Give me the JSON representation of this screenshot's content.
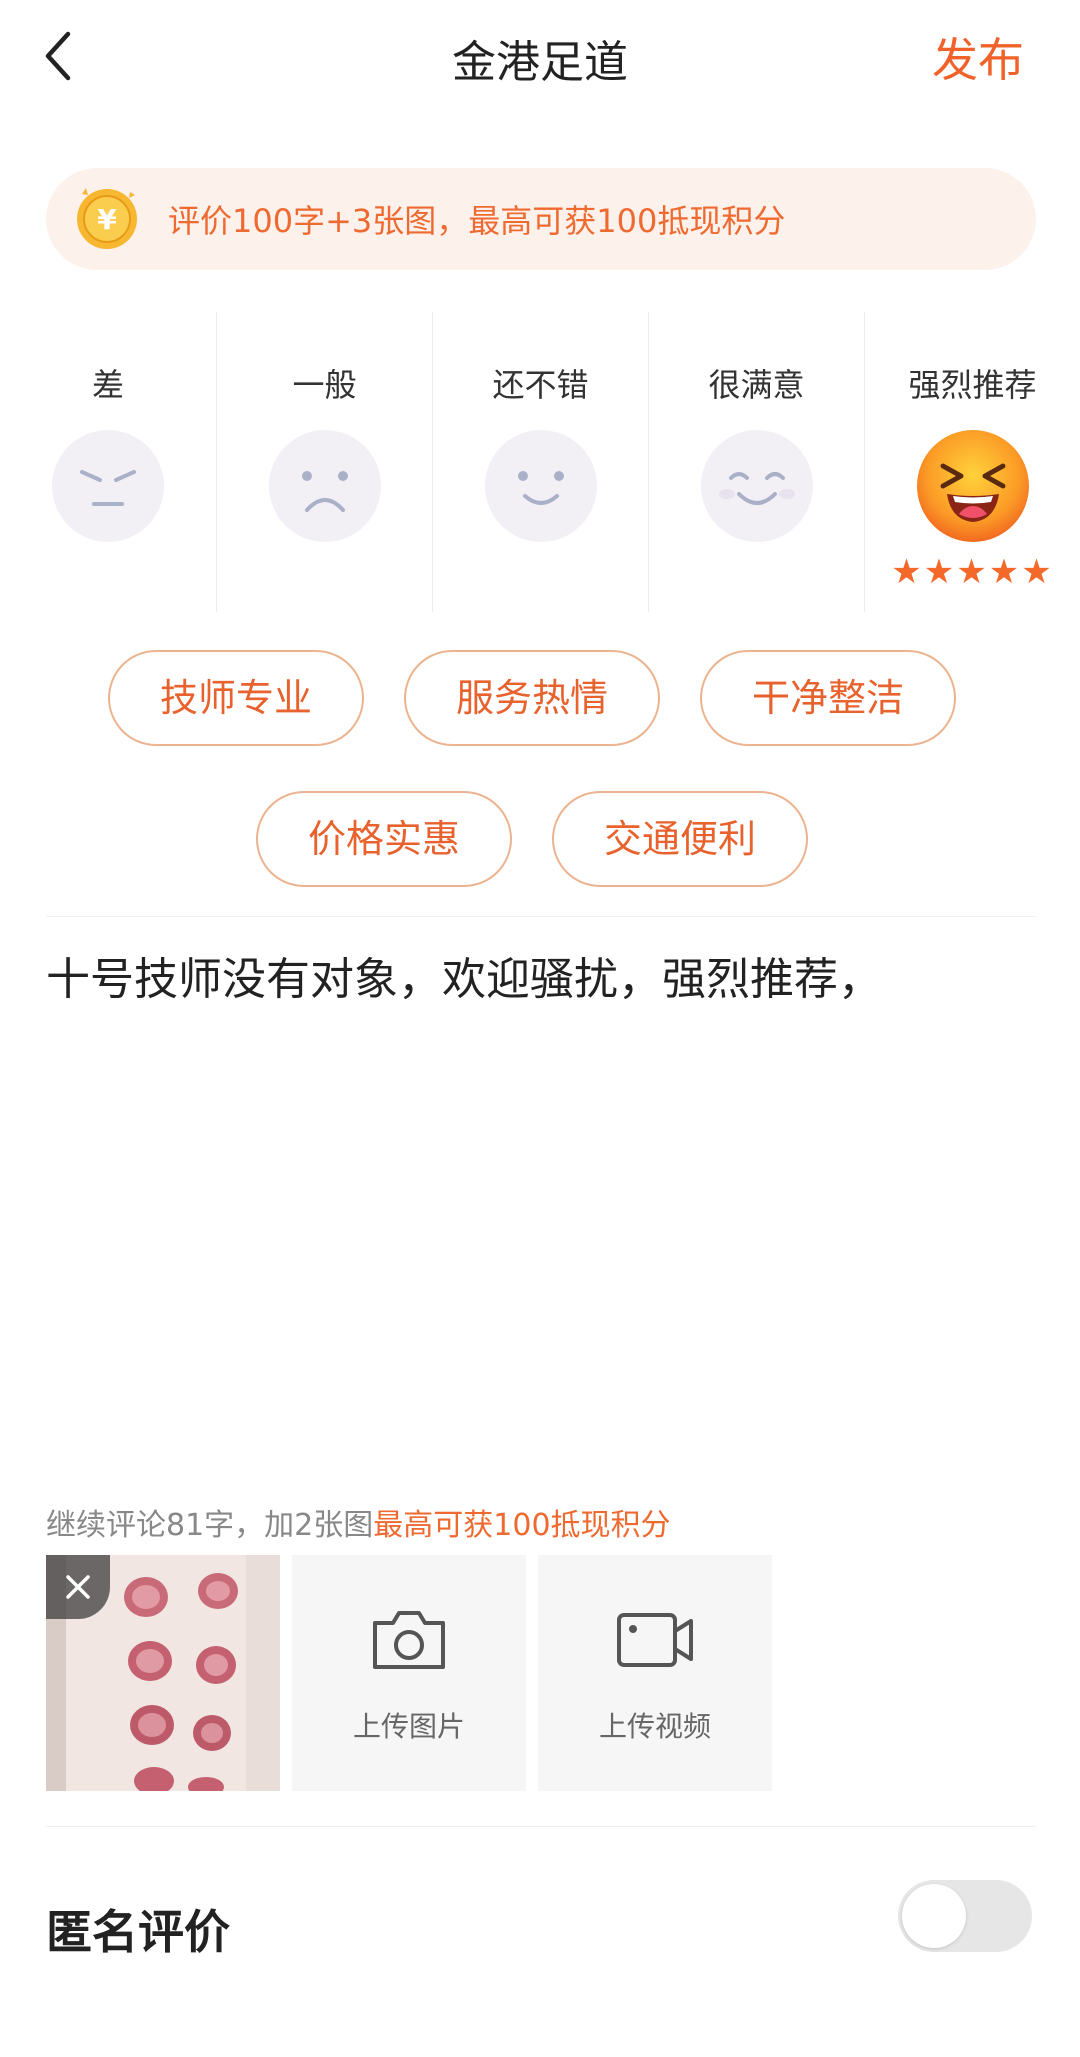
{
  "header": {
    "title": "金港足道",
    "publish_label": "发布"
  },
  "banner": {
    "text": "评价100字+3张图，最高可获100抵现积分"
  },
  "ratings": [
    {
      "label": "差",
      "selected": false
    },
    {
      "label": "一般",
      "selected": false
    },
    {
      "label": "还不错",
      "selected": false
    },
    {
      "label": "很满意",
      "selected": false
    },
    {
      "label": "强烈推荐",
      "selected": true,
      "stars": "★★★★★"
    }
  ],
  "tags": [
    "技师专业",
    "服务热情",
    "干净整洁",
    "价格实惠",
    "交通便利"
  ],
  "review": {
    "text": "十号技师没有对象，欢迎骚扰，强烈推荐，"
  },
  "hint": {
    "prefix": "继续评论81字，加2张图",
    "highlight": "最高可获100抵现积分"
  },
  "media": {
    "upload_photo_label": "上传图片",
    "upload_video_label": "上传视频"
  },
  "anonymous": {
    "label": "匿名评价",
    "enabled": false
  },
  "colors": {
    "accent": "#f0622a",
    "banner_bg": "#fdf1ec",
    "tag_border": "#ecb38f"
  }
}
